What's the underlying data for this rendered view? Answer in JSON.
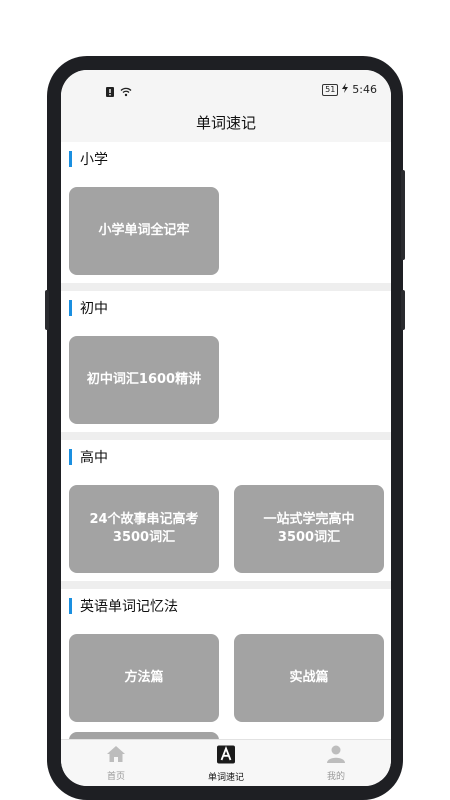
{
  "status_bar": {
    "time": "5:46",
    "battery": "51"
  },
  "header": {
    "title": "单词速记"
  },
  "sections": [
    {
      "title": "小学",
      "cards": [
        "小学单词全记牢"
      ]
    },
    {
      "title": "初中",
      "cards": [
        "初中词汇1600精讲"
      ]
    },
    {
      "title": "高中",
      "cards": [
        "24个故事串记高考3500词汇",
        "一站式学完高中3500词汇"
      ]
    },
    {
      "title": "英语单词记忆法",
      "cards": [
        "方法篇",
        "实战篇"
      ]
    }
  ],
  "tabbar": {
    "items": [
      {
        "label": "首页",
        "icon": "home-icon"
      },
      {
        "label": "单词速记",
        "icon": "letter-a-icon"
      },
      {
        "label": "我的",
        "icon": "person-icon"
      }
    ],
    "active_index": 1
  },
  "colors": {
    "accent_bar": "#1a8fe0",
    "card": "#a3a3a3",
    "bar_bg": "#f5f5f5"
  }
}
